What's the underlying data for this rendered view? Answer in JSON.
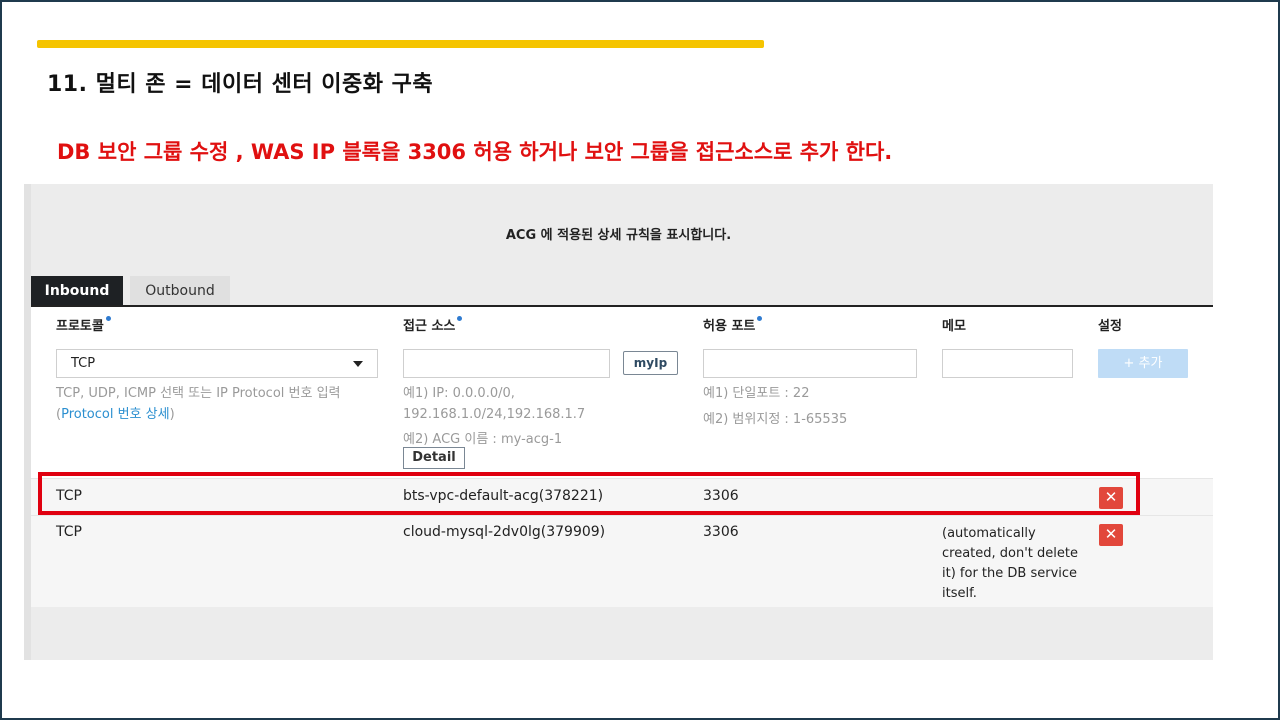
{
  "slide": {
    "title": "11. 멀티 존 = 데이터 센터 이중화 구축",
    "subtitle": "DB 보안 그룹 수정 , WAS IP 블록을 3306 허용 하거나  보안 그룹을 접근소스로 추가 한다."
  },
  "acg": {
    "caption": "ACG 에 적용된 상세 규칙을 표시합니다.",
    "tabs": [
      {
        "label": "Inbound",
        "active": true
      },
      {
        "label": "Outbound",
        "active": false
      }
    ],
    "columns": {
      "protocol": "프로토콜",
      "source": "접근 소스",
      "port": "허용 포트",
      "memo": "메모",
      "setting": "설정"
    },
    "form": {
      "protocol_value": "TCP",
      "source_value": "",
      "port_value": "",
      "memo_value": "",
      "myip_label": "myIp",
      "add_label": "+ 추가",
      "detail_label": "Detail",
      "protocol_hint_1": "TCP, UDP, ICMP 선택 또는 IP Protocol 번호 입력",
      "protocol_hint_open": "(",
      "protocol_hint_link": "Protocol 번호 상세",
      "protocol_hint_close": ")",
      "source_hint_1": "예1) IP: 0.0.0.0/0,",
      "source_hint_2": "192.168.1.0/24,192.168.1.7",
      "source_hint_3": "예2) ACG 이름 : my-acg-1",
      "port_hint_1": "예1) 단일포트 : 22",
      "port_hint_2": "예2) 범위지정 : 1-65535"
    },
    "rules": [
      {
        "protocol": "TCP",
        "source": "bts-vpc-default-acg(378221)",
        "port": "3306",
        "memo": ""
      },
      {
        "protocol": "TCP",
        "source": "cloud-mysql-2dv0lg(379909)",
        "port": "3306",
        "memo": "(automatically created, don't delete it) for the DB service itself."
      }
    ],
    "delete_glyph": "✕"
  },
  "colors": {
    "accent_bar": "#f5c400",
    "subtitle": "#e01010",
    "highlight": "#e00010",
    "delete": "#e2473b",
    "add_button": "#bfdcf6",
    "link": "#2b8fd0"
  }
}
